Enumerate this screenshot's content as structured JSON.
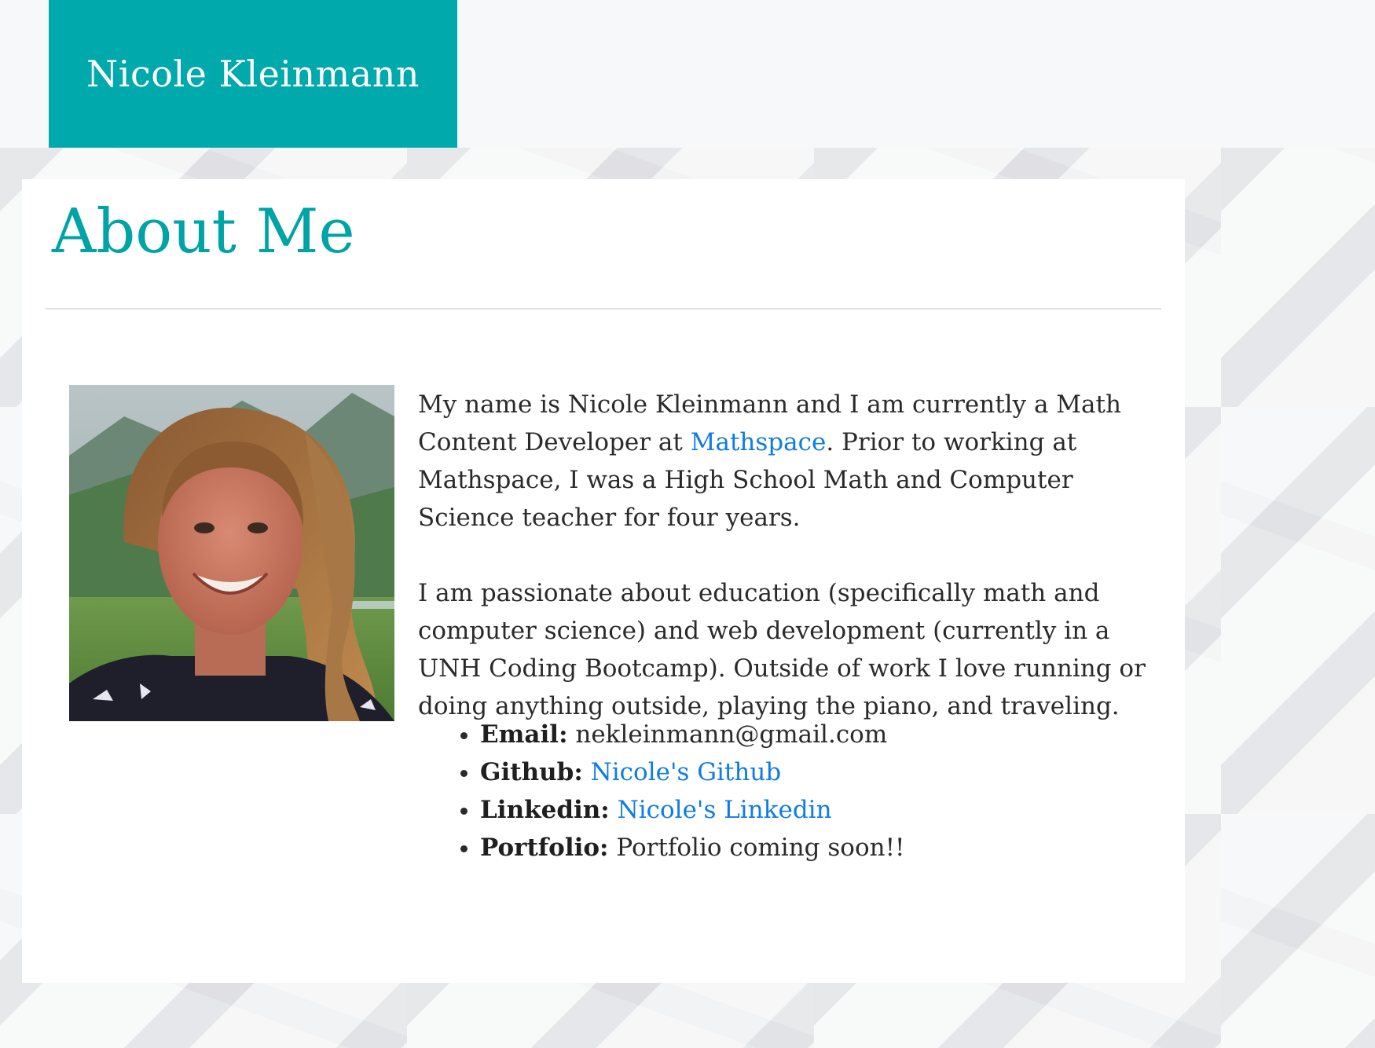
{
  "header": {
    "site_title": "Nicole Kleinmann"
  },
  "about": {
    "heading": "About Me",
    "photo_alt": "Portrait photo of Nicole Kleinmann",
    "paragraph1_before_link": "My name is Nicole Kleinmann and I am currently a Math Content Developer at ",
    "paragraph1_link": "Mathspace",
    "paragraph1_after_link": ". Prior to working at Mathspace, I was a High School Math and Computer Science teacher for four years.",
    "paragraph2": "I am passionate about education (specifically math and computer science) and web development (currently in a UNH Coding Bootcamp). Outside of work I love running or doing anything outside, playing the piano, and traveling."
  },
  "contacts": [
    {
      "label": "Email:",
      "value": "nekleinmann@gmail.com",
      "is_link": false
    },
    {
      "label": "Github:",
      "value": "Nicole's Github",
      "is_link": true
    },
    {
      "label": "Linkedin:",
      "value": "Nicole's Linkedin",
      "is_link": true
    },
    {
      "label": "Portfolio:",
      "value": "Portfolio coming soon!!",
      "is_link": false
    }
  ],
  "colors": {
    "brand_teal": "#00a9ac",
    "heading_teal": "#00a3a6",
    "link_blue": "#0f7be6"
  }
}
